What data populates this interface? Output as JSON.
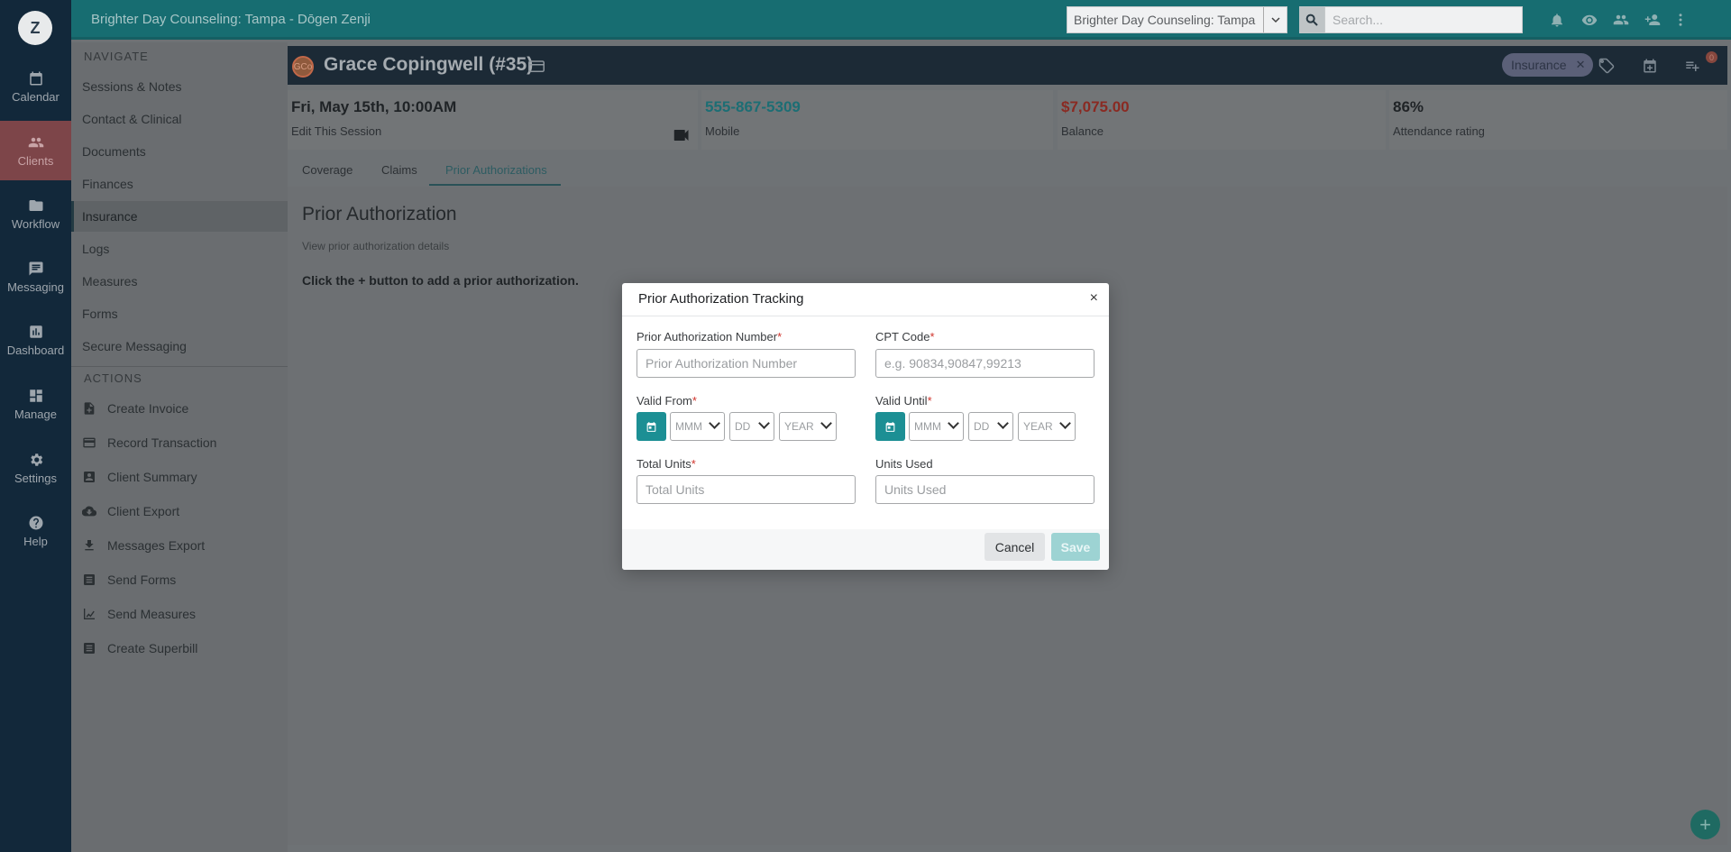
{
  "app": {
    "logo_letter": "Z",
    "top_title": "Brighter Day Counseling: Tampa - Dōgen Zenji",
    "practice_select_value": "Brighter Day Counseling: Tampa",
    "search_placeholder": "Search..."
  },
  "rail": {
    "items": [
      {
        "label": "Calendar",
        "icon": "calendar-icon"
      },
      {
        "label": "Clients",
        "icon": "clients-icon"
      },
      {
        "label": "Workflow",
        "icon": "folder-icon"
      },
      {
        "label": "Messaging",
        "icon": "chat-icon"
      },
      {
        "label": "Dashboard",
        "icon": "chart-icon"
      },
      {
        "label": "Manage",
        "icon": "grid-icon"
      },
      {
        "label": "Settings",
        "icon": "gear-icon"
      },
      {
        "label": "Help",
        "icon": "help-icon"
      }
    ],
    "active": "Clients"
  },
  "nav": {
    "navigate_heading": "NAVIGATE",
    "items": [
      "Sessions & Notes",
      "Contact & Clinical",
      "Documents",
      "Finances",
      "Insurance",
      "Logs",
      "Measures",
      "Forms",
      "Secure Messaging"
    ],
    "active": "Insurance",
    "actions_heading": "ACTIONS",
    "actions": [
      "Create Invoice",
      "Record Transaction",
      "Client Summary",
      "Client Export",
      "Messages Export",
      "Send Forms",
      "Send Measures",
      "Create Superbill"
    ]
  },
  "client": {
    "initials": "GCo",
    "name": "Grace Copingwell (#35)",
    "tag": "Insurance",
    "notification_count": "0"
  },
  "stats": [
    {
      "value": "Fri, May 15th, 10:00AM",
      "label": "Edit This Session",
      "color": "#1f2326"
    },
    {
      "value": "555-867-5309",
      "label": "Mobile",
      "color": "#1c6e74"
    },
    {
      "value": "$7,075.00",
      "label": "Balance",
      "color": "#8a2a22"
    },
    {
      "value": "86%",
      "label": "Attendance rating",
      "color": "#1f2326"
    }
  ],
  "tabs": [
    "Coverage",
    "Claims",
    "Prior Authorizations"
  ],
  "active_tab": "Prior Authorizations",
  "page": {
    "title": "Prior Authorization",
    "subtitle": "View prior authorization details",
    "empty_message": "Click the + button to add a prior authorization.",
    "fab_label": "+"
  },
  "modal": {
    "title": "Prior Authorization Tracking",
    "close": "×",
    "pa_number_label": "Prior Authorization Number",
    "pa_number_placeholder": "Prior Authorization Number",
    "cpt_label": "CPT Code",
    "cpt_placeholder": "e.g. 90834,90847,99213",
    "valid_from_label": "Valid From",
    "valid_until_label": "Valid Until",
    "month_placeholder": "MMM",
    "day_placeholder": "DD",
    "year_placeholder": "YEAR",
    "total_units_label": "Total Units",
    "total_units_placeholder": "Total Units",
    "units_used_label": "Units Used",
    "units_used_placeholder": "Units Used",
    "required_mark": "*",
    "cancel_label": "Cancel",
    "save_label": "Save"
  }
}
